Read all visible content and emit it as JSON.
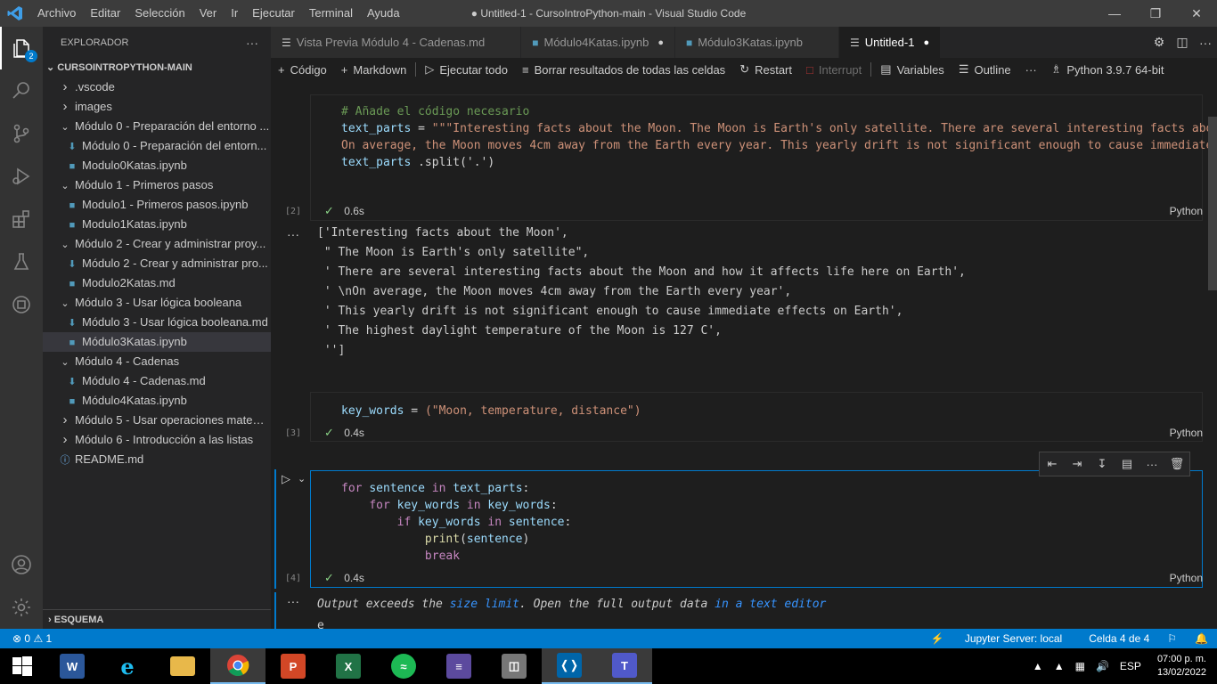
{
  "titlebar": {
    "menu": [
      "Archivo",
      "Editar",
      "Selección",
      "Ver",
      "Ir",
      "Ejecutar",
      "Terminal",
      "Ayuda"
    ],
    "title": "● Untitled-1 - CursoIntroPython-main - Visual Studio Code"
  },
  "activitybar": {
    "badge": "2"
  },
  "sidebar": {
    "header": "EXPLORADOR",
    "root": "CURSOINTROPYTHON-MAIN",
    "items": [
      {
        "label": ".vscode",
        "type": "folder-closed",
        "indent": 0
      },
      {
        "label": "images",
        "type": "folder-closed",
        "indent": 0
      },
      {
        "label": "Módulo 0 - Preparación del entorno ...",
        "type": "folder-open",
        "indent": 0
      },
      {
        "label": "Módulo 0 - Preparación del entorn...",
        "type": "md",
        "indent": 1
      },
      {
        "label": "Modulo0Katas.ipynb",
        "type": "nb",
        "indent": 1
      },
      {
        "label": "Módulo 1 - Primeros pasos",
        "type": "folder-open",
        "indent": 0
      },
      {
        "label": "Modulo1 - Primeros pasos.ipynb",
        "type": "nb",
        "indent": 1
      },
      {
        "label": "Modulo1Katas.ipynb",
        "type": "nb",
        "indent": 1
      },
      {
        "label": "Módulo 2 - Crear y administrar proy...",
        "type": "folder-open",
        "indent": 0
      },
      {
        "label": "Módulo 2 - Crear y administrar pro...",
        "type": "md",
        "indent": 1
      },
      {
        "label": "Modulo2Katas.md",
        "type": "nb",
        "indent": 1
      },
      {
        "label": "Módulo 3 - Usar lógica booleana",
        "type": "folder-open",
        "indent": 0
      },
      {
        "label": "Módulo 3 - Usar lógica booleana.md",
        "type": "md",
        "indent": 1
      },
      {
        "label": "Módulo3Katas.ipynb",
        "type": "nb",
        "indent": 1,
        "selected": true
      },
      {
        "label": "Módulo 4 - Cadenas",
        "type": "folder-open",
        "indent": 0
      },
      {
        "label": "Módulo 4 - Cadenas.md",
        "type": "md",
        "indent": 1
      },
      {
        "label": "Módulo4Katas.ipynb",
        "type": "nb",
        "indent": 1
      },
      {
        "label": "Módulo 5 - Usar operaciones matem...",
        "type": "folder-closed",
        "indent": 0
      },
      {
        "label": "Módulo 6 - Introducción a las listas",
        "type": "folder-closed",
        "indent": 0
      },
      {
        "label": "README.md",
        "type": "info",
        "indent": 0
      }
    ],
    "outline": "ESQUEMA"
  },
  "tabs": [
    {
      "label": "Vista Previa Módulo 4 - Cadenas.md",
      "icon": "preview-icon",
      "dirty": false,
      "active": false
    },
    {
      "label": "Módulo4Katas.ipynb",
      "icon": "notebook-icon",
      "dirty": true,
      "active": false
    },
    {
      "label": "Módulo3Katas.ipynb",
      "icon": "notebook-icon",
      "dirty": false,
      "active": false
    },
    {
      "label": "Untitled-1",
      "icon": "notebook-icon",
      "dirty": true,
      "active": true
    }
  ],
  "toolbar": {
    "code": "Código",
    "markdown": "Markdown",
    "run_all": "Ejecutar todo",
    "clear": "Borrar resultados de todas las celdas",
    "restart": "Restart",
    "interrupt": "Interrupt",
    "variables": "Variables",
    "outline": "Outline",
    "kernel": "Python 3.9.7 64-bit"
  },
  "cells": {
    "c2": {
      "comment": "# Añade el código necesario",
      "line1_var": "text_parts",
      "line1_str": "\"\"\"Interesting facts about the Moon. The Moon is Earth's only satellite. There are several interesting facts abou",
      "line2_str": "On average, the Moon moves 4cm away from the Earth every year. This yearly drift is not significant enough to cause immediate",
      "line3_var": "text_parts",
      "line3_rest": ".split('.')",
      "exec": "[2]",
      "time": "0.6s",
      "lang": "Python",
      "output": [
        "['Interesting facts about the Moon',",
        " \" The Moon is Earth's only satellite\",",
        " ' There are several interesting facts about the Moon and how it affects life here on Earth',",
        " ' \\nOn average, the Moon moves 4cm away from the Earth every year',",
        " ' This yearly drift is not significant enough to cause immediate effects on Earth',",
        " ' The highest daylight temperature of the Moon is 127 C',",
        " '']"
      ]
    },
    "c3": {
      "var": "key_words",
      "str": "(\"Moon, temperature, distance\")",
      "exec": "[3]",
      "time": "0.4s",
      "lang": "Python"
    },
    "c4": {
      "l1_kw": "for",
      "l1_a": "sentence",
      "l1_in": "in",
      "l1_b": "text_parts",
      "l2_kw": "for",
      "l2_a": "key_words",
      "l2_in": "in",
      "l2_b": "key_words",
      "l3_kw": "if",
      "l3_a": "key_words",
      "l3_in": "in",
      "l3_b": "sentence",
      "l4_fn": "print",
      "l4_arg": "sentence",
      "l5_kw": "break",
      "exec": "[4]",
      "time": "0.4s",
      "lang": "Python",
      "output_notice": {
        "a": "Output exceeds the ",
        "link1": "size limit",
        "b": ". Open the full output data ",
        "link2": "in a text editor"
      },
      "output_first": "e"
    }
  },
  "statusbar": {
    "errors": "0",
    "warnings": "1",
    "jupyter": "Jupyter Server: local",
    "cell": "Celda 4 de 4"
  },
  "taskbar": {
    "lang": "ESP",
    "time": "07:00 p. m.",
    "date": "13/02/2022"
  }
}
